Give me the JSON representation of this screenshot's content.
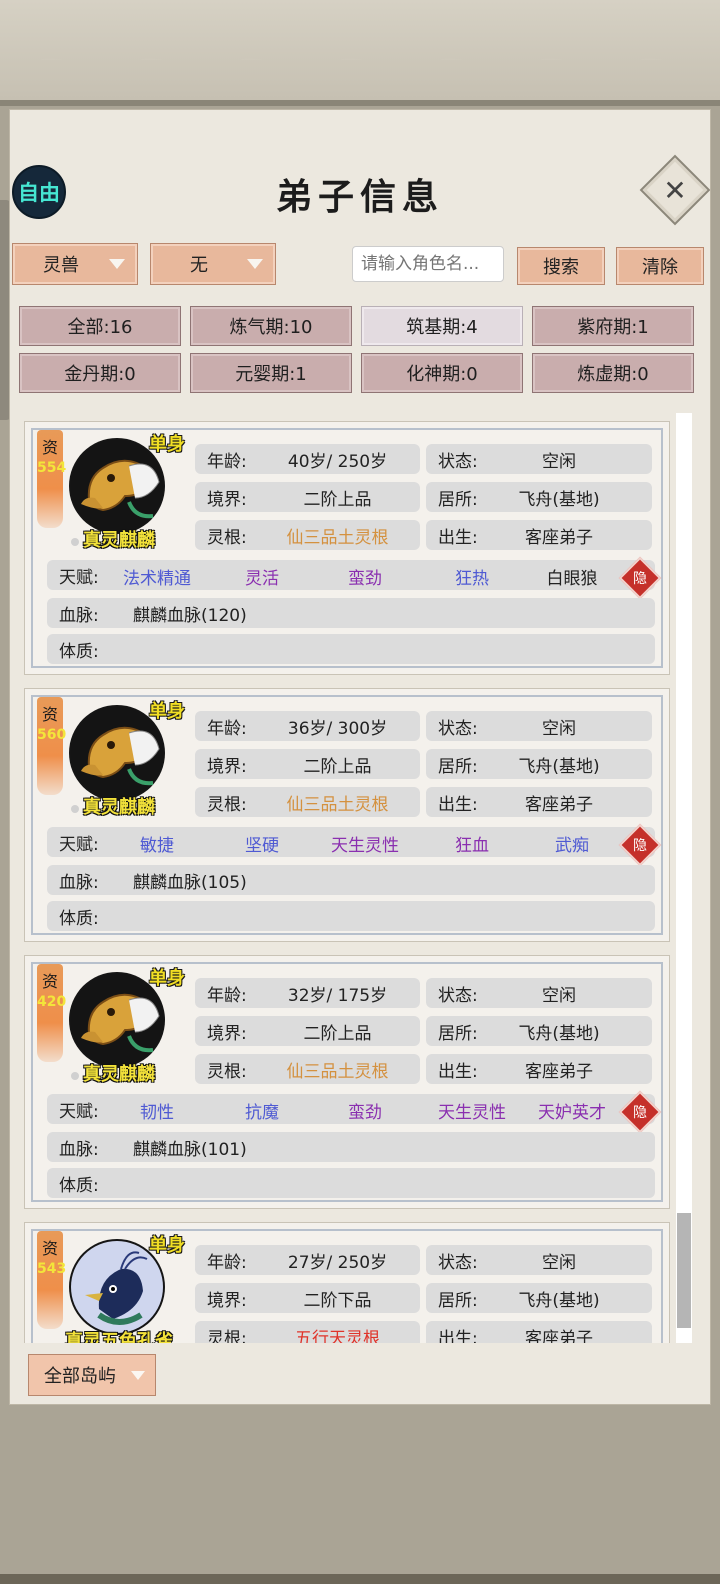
{
  "header": {
    "free_label": "自由",
    "title": "弟子信息",
    "close_icon": "close-icon"
  },
  "filters_top": {
    "type_select": "灵兽",
    "sub_select": "无",
    "search_placeholder": "请输入角色名...",
    "search_btn": "搜索",
    "clear_btn": "清除"
  },
  "realm_filters": [
    {
      "label": "全部:16",
      "active": false
    },
    {
      "label": "炼气期:10",
      "active": false
    },
    {
      "label": "筑基期:4",
      "active": true
    },
    {
      "label": "紫府期:1",
      "active": false
    },
    {
      "label": "金丹期:0",
      "active": false
    },
    {
      "label": "元婴期:1",
      "active": false
    },
    {
      "label": "化神期:0",
      "active": false
    },
    {
      "label": "炼虚期:0",
      "active": false
    }
  ],
  "labels": {
    "zi": "资",
    "single": "单身",
    "age": "年龄:",
    "status": "状态:",
    "realm": "境界:",
    "residence": "居所:",
    "root": "灵根:",
    "birth": "出生:",
    "talent": "天赋:",
    "bloodline": "血脉:",
    "physique": "体质:",
    "hide": "隐"
  },
  "disciples": [
    {
      "aptitude": "554",
      "name": "真灵麒麟",
      "age": "40岁/ 250岁",
      "status": "空闲",
      "realm": "二阶上品",
      "residence": "飞舟(基地)",
      "root": "仙三品土灵根",
      "root_color": "#d4913f",
      "birth": "客座弟子",
      "talents": [
        {
          "t": "法术精通",
          "c": "#4f5ad3"
        },
        {
          "t": "灵活",
          "c": "#8a2fb0"
        },
        {
          "t": "蛮劲",
          "c": "#8a2fb0"
        },
        {
          "t": "狂热",
          "c": "#4f5ad3"
        },
        {
          "t": "白眼狼",
          "c": "#222222"
        }
      ],
      "bloodline": "麒麟血脉(120)",
      "physique": ""
    },
    {
      "aptitude": "560",
      "name": "真灵麒麟",
      "age": "36岁/ 300岁",
      "status": "空闲",
      "realm": "二阶上品",
      "residence": "飞舟(基地)",
      "root": "仙三品土灵根",
      "root_color": "#d4913f",
      "birth": "客座弟子",
      "talents": [
        {
          "t": "敏捷",
          "c": "#4f5ad3"
        },
        {
          "t": "坚硬",
          "c": "#4f5ad3"
        },
        {
          "t": "天生灵性",
          "c": "#8a2fb0"
        },
        {
          "t": "狂血",
          "c": "#8a2fb0"
        },
        {
          "t": "武痴",
          "c": "#4f5ad3"
        }
      ],
      "bloodline": "麒麟血脉(105)",
      "physique": ""
    },
    {
      "aptitude": "420",
      "name": "真灵麒麟",
      "age": "32岁/ 175岁",
      "status": "空闲",
      "realm": "二阶上品",
      "residence": "飞舟(基地)",
      "root": "仙三品土灵根",
      "root_color": "#d4913f",
      "birth": "客座弟子",
      "talents": [
        {
          "t": "韧性",
          "c": "#4f5ad3"
        },
        {
          "t": "抗魔",
          "c": "#4f5ad3"
        },
        {
          "t": "蛮劲",
          "c": "#8a2fb0"
        },
        {
          "t": "天生灵性",
          "c": "#8a2fb0"
        },
        {
          "t": "天妒英才",
          "c": "#8a2fb0"
        }
      ],
      "bloodline": "麒麟血脉(101)",
      "physique": ""
    },
    {
      "aptitude": "543",
      "name": "真灵五色孔雀",
      "age": "27岁/ 250岁",
      "status": "空闲",
      "realm": "二阶下品",
      "residence": "飞舟(基地)",
      "root": "五行天灵根",
      "root_color": "#e0342a",
      "birth": "客座弟子",
      "talents": [],
      "bloodline": "",
      "physique": ""
    }
  ],
  "bottom": {
    "island_select": "全部岛屿"
  }
}
